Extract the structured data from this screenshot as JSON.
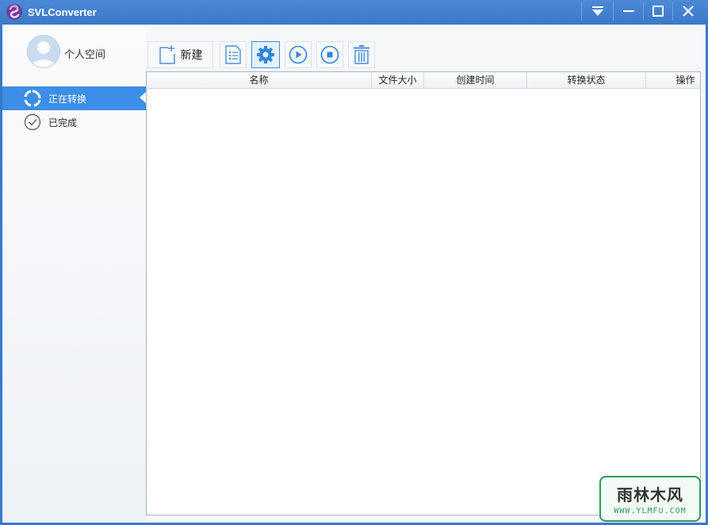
{
  "window": {
    "title": "SVLConverter",
    "accent": "#3c8ee6",
    "titlebar_color": "#3b79c9"
  },
  "titlebar_buttons": [
    {
      "name": "dropdown-menu",
      "icon": "triangle-down-icon"
    },
    {
      "name": "minimize",
      "icon": "minimize-icon"
    },
    {
      "name": "maximize",
      "icon": "maximize-icon"
    },
    {
      "name": "close",
      "icon": "close-icon"
    }
  ],
  "user": {
    "label": "个人空间",
    "icon": "avatar-icon"
  },
  "sidebar": {
    "items": [
      {
        "label": "正在转换",
        "icon": "converting-icon",
        "active": true
      },
      {
        "label": "已完成",
        "icon": "check-circle-icon",
        "active": false
      }
    ]
  },
  "toolbar": {
    "new_label": "新建",
    "tools": [
      {
        "name": "new",
        "icon": "new-file-icon"
      },
      {
        "name": "list",
        "icon": "list-icon"
      },
      {
        "name": "settings",
        "icon": "gear-icon",
        "selected": true
      },
      {
        "name": "start",
        "icon": "play-icon"
      },
      {
        "name": "stop",
        "icon": "stop-icon"
      },
      {
        "name": "delete",
        "icon": "trash-icon"
      }
    ]
  },
  "table": {
    "columns": [
      "名称",
      "文件大小",
      "创建时间",
      "转换状态",
      "操作"
    ],
    "rows": []
  },
  "watermark": {
    "main": "雨林木风",
    "sub": "WWW.YLMFU.COM"
  }
}
